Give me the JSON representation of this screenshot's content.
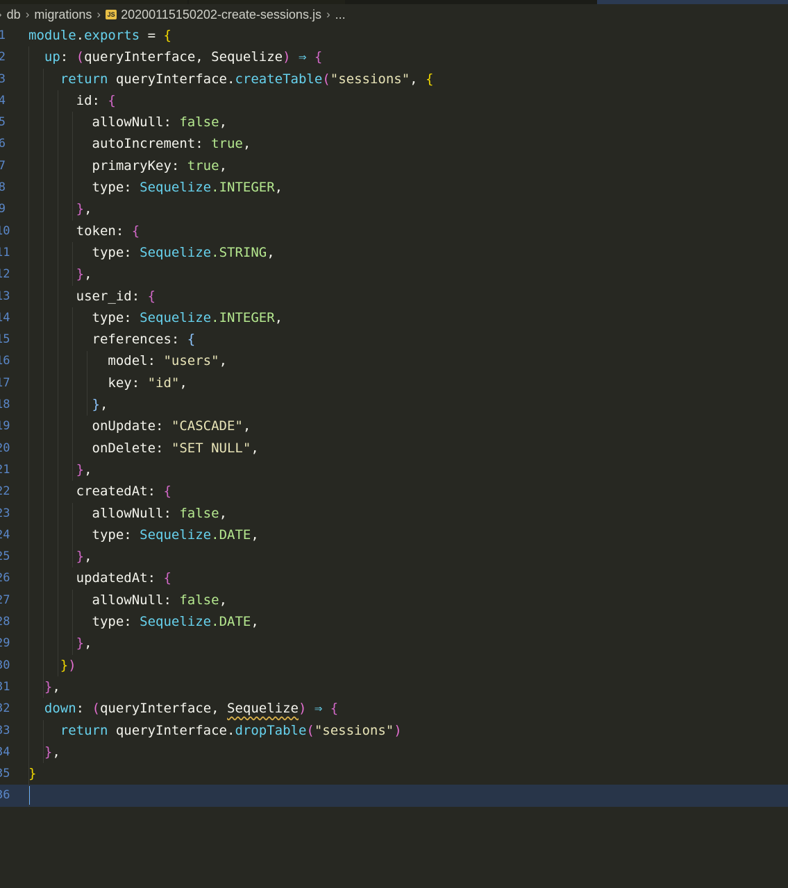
{
  "colors": {
    "plain": "#f4f4ed",
    "blue": "#67d2ee",
    "keyword": "#67d2ee",
    "func": "#67d2ee",
    "string": "#e8e4b7",
    "bool": "#b5e88f",
    "paren": "#e46fd1",
    "brace_yellow": "#f1d800",
    "brace_purple": "#d268c8",
    "brace_blue": "#8ec6ff",
    "arrow": "#67d2ee",
    "punct": "#f4f4ed"
  },
  "breadcrumb": {
    "folder1": "db",
    "folder2": "migrations",
    "file_icon": "js-file-icon",
    "file_badge": "JS",
    "file": "20200115150202-create-sessions.js",
    "tail": "..."
  },
  "editor": {
    "current_line_index": 35,
    "lines": [
      {
        "n": "1",
        "t": [
          [
            "module",
            "blue"
          ],
          [
            ".",
            "plain"
          ],
          [
            "exports",
            "blue"
          ],
          [
            " = ",
            "plain"
          ],
          [
            "{",
            "brace_yellow"
          ]
        ]
      },
      {
        "n": "2",
        "t": [
          [
            "  up",
            "blue"
          ],
          [
            ": ",
            "plain"
          ],
          [
            "(",
            "paren"
          ],
          [
            "queryInterface",
            "plain"
          ],
          [
            ", ",
            "plain"
          ],
          [
            "Sequelize",
            "plain"
          ],
          [
            ")",
            "paren"
          ],
          [
            " ⇒ ",
            "arrow"
          ],
          [
            "{",
            "brace_purple"
          ]
        ]
      },
      {
        "n": "3",
        "t": [
          [
            "    return ",
            "keyword"
          ],
          [
            "queryInterface",
            "plain"
          ],
          [
            ".",
            "plain"
          ],
          [
            "createTable",
            "func"
          ],
          [
            "(",
            "paren"
          ],
          [
            "\"sessions\"",
            "string"
          ],
          [
            ", ",
            "plain"
          ],
          [
            "{",
            "brace_yellow"
          ]
        ]
      },
      {
        "n": "4",
        "t": [
          [
            "      id",
            "plain"
          ],
          [
            ": ",
            "plain"
          ],
          [
            "{",
            "brace_purple"
          ]
        ]
      },
      {
        "n": "5",
        "t": [
          [
            "        allowNull",
            "plain"
          ],
          [
            ": ",
            "plain"
          ],
          [
            "false",
            "bool"
          ],
          [
            ",",
            "plain"
          ]
        ]
      },
      {
        "n": "6",
        "t": [
          [
            "        autoIncrement",
            "plain"
          ],
          [
            ": ",
            "plain"
          ],
          [
            "true",
            "bool"
          ],
          [
            ",",
            "plain"
          ]
        ]
      },
      {
        "n": "7",
        "t": [
          [
            "        primaryKey",
            "plain"
          ],
          [
            ": ",
            "plain"
          ],
          [
            "true",
            "bool"
          ],
          [
            ",",
            "plain"
          ]
        ]
      },
      {
        "n": "8",
        "t": [
          [
            "        type",
            "plain"
          ],
          [
            ": ",
            "plain"
          ],
          [
            "Sequelize",
            "blue"
          ],
          [
            ".INTEGER",
            "bool"
          ],
          [
            ",",
            "plain"
          ]
        ]
      },
      {
        "n": "9",
        "t": [
          [
            "      ",
            "plain"
          ],
          [
            "}",
            "brace_purple"
          ],
          [
            ",",
            "plain"
          ]
        ]
      },
      {
        "n": "10",
        "t": [
          [
            "      token",
            "plain"
          ],
          [
            ": ",
            "plain"
          ],
          [
            "{",
            "brace_purple"
          ]
        ]
      },
      {
        "n": "11",
        "t": [
          [
            "        type",
            "plain"
          ],
          [
            ": ",
            "plain"
          ],
          [
            "Sequelize",
            "blue"
          ],
          [
            ".STRING",
            "bool"
          ],
          [
            ",",
            "plain"
          ]
        ]
      },
      {
        "n": "12",
        "t": [
          [
            "      ",
            "plain"
          ],
          [
            "}",
            "brace_purple"
          ],
          [
            ",",
            "plain"
          ]
        ]
      },
      {
        "n": "13",
        "t": [
          [
            "      user_id",
            "plain"
          ],
          [
            ": ",
            "plain"
          ],
          [
            "{",
            "brace_purple"
          ]
        ]
      },
      {
        "n": "14",
        "t": [
          [
            "        type",
            "plain"
          ],
          [
            ": ",
            "plain"
          ],
          [
            "Sequelize",
            "blue"
          ],
          [
            ".INTEGER",
            "bool"
          ],
          [
            ",",
            "plain"
          ]
        ]
      },
      {
        "n": "15",
        "t": [
          [
            "        references",
            "plain"
          ],
          [
            ": ",
            "plain"
          ],
          [
            "{",
            "brace_blue"
          ]
        ]
      },
      {
        "n": "16",
        "t": [
          [
            "          model",
            "plain"
          ],
          [
            ": ",
            "plain"
          ],
          [
            "\"users\"",
            "string"
          ],
          [
            ",",
            "plain"
          ]
        ]
      },
      {
        "n": "17",
        "t": [
          [
            "          key",
            "plain"
          ],
          [
            ": ",
            "plain"
          ],
          [
            "\"id\"",
            "string"
          ],
          [
            ",",
            "plain"
          ]
        ]
      },
      {
        "n": "18",
        "t": [
          [
            "        ",
            "plain"
          ],
          [
            "}",
            "brace_blue"
          ],
          [
            ",",
            "plain"
          ]
        ]
      },
      {
        "n": "19",
        "t": [
          [
            "        onUpdate",
            "plain"
          ],
          [
            ": ",
            "plain"
          ],
          [
            "\"CASCADE\"",
            "string"
          ],
          [
            ",",
            "plain"
          ]
        ]
      },
      {
        "n": "20",
        "t": [
          [
            "        onDelete",
            "plain"
          ],
          [
            ": ",
            "plain"
          ],
          [
            "\"SET NULL\"",
            "string"
          ],
          [
            ",",
            "plain"
          ]
        ]
      },
      {
        "n": "21",
        "t": [
          [
            "      ",
            "plain"
          ],
          [
            "}",
            "brace_purple"
          ],
          [
            ",",
            "plain"
          ]
        ]
      },
      {
        "n": "22",
        "t": [
          [
            "      createdAt",
            "plain"
          ],
          [
            ": ",
            "plain"
          ],
          [
            "{",
            "brace_purple"
          ]
        ]
      },
      {
        "n": "23",
        "t": [
          [
            "        allowNull",
            "plain"
          ],
          [
            ": ",
            "plain"
          ],
          [
            "false",
            "bool"
          ],
          [
            ",",
            "plain"
          ]
        ]
      },
      {
        "n": "24",
        "t": [
          [
            "        type",
            "plain"
          ],
          [
            ": ",
            "plain"
          ],
          [
            "Sequelize",
            "blue"
          ],
          [
            ".DATE",
            "bool"
          ],
          [
            ",",
            "plain"
          ]
        ]
      },
      {
        "n": "25",
        "t": [
          [
            "      ",
            "plain"
          ],
          [
            "}",
            "brace_purple"
          ],
          [
            ",",
            "plain"
          ]
        ]
      },
      {
        "n": "26",
        "t": [
          [
            "      updatedAt",
            "plain"
          ],
          [
            ": ",
            "plain"
          ],
          [
            "{",
            "brace_purple"
          ]
        ]
      },
      {
        "n": "27",
        "t": [
          [
            "        allowNull",
            "plain"
          ],
          [
            ": ",
            "plain"
          ],
          [
            "false",
            "bool"
          ],
          [
            ",",
            "plain"
          ]
        ]
      },
      {
        "n": "28",
        "t": [
          [
            "        type",
            "plain"
          ],
          [
            ": ",
            "plain"
          ],
          [
            "Sequelize",
            "blue"
          ],
          [
            ".DATE",
            "bool"
          ],
          [
            ",",
            "plain"
          ]
        ]
      },
      {
        "n": "29",
        "t": [
          [
            "      ",
            "plain"
          ],
          [
            "}",
            "brace_purple"
          ],
          [
            ",",
            "plain"
          ]
        ]
      },
      {
        "n": "30",
        "t": [
          [
            "    ",
            "plain"
          ],
          [
            "}",
            "brace_yellow"
          ],
          [
            ")",
            "paren"
          ]
        ]
      },
      {
        "n": "31",
        "t": [
          [
            "  ",
            "plain"
          ],
          [
            "}",
            "brace_purple"
          ],
          [
            ",",
            "plain"
          ]
        ]
      },
      {
        "n": "32",
        "t": [
          [
            "  down",
            "blue"
          ],
          [
            ": ",
            "plain"
          ],
          [
            "(",
            "paren"
          ],
          [
            "queryInterface",
            "plain"
          ],
          [
            ", ",
            "plain"
          ],
          [
            "Sequelize",
            "plain",
            "squiggle"
          ],
          [
            ")",
            "paren"
          ],
          [
            " ⇒ ",
            "arrow"
          ],
          [
            "{",
            "brace_purple"
          ]
        ]
      },
      {
        "n": "33",
        "t": [
          [
            "    return ",
            "keyword"
          ],
          [
            "queryInterface",
            "plain"
          ],
          [
            ".",
            "plain"
          ],
          [
            "dropTable",
            "func"
          ],
          [
            "(",
            "paren"
          ],
          [
            "\"sessions\"",
            "string"
          ],
          [
            ")",
            "paren"
          ]
        ]
      },
      {
        "n": "34",
        "t": [
          [
            "  ",
            "plain"
          ],
          [
            "}",
            "brace_purple"
          ],
          [
            ",",
            "plain"
          ]
        ]
      },
      {
        "n": "35",
        "t": [
          [
            "}",
            "brace_yellow"
          ]
        ]
      },
      {
        "n": "36",
        "t": []
      }
    ]
  }
}
